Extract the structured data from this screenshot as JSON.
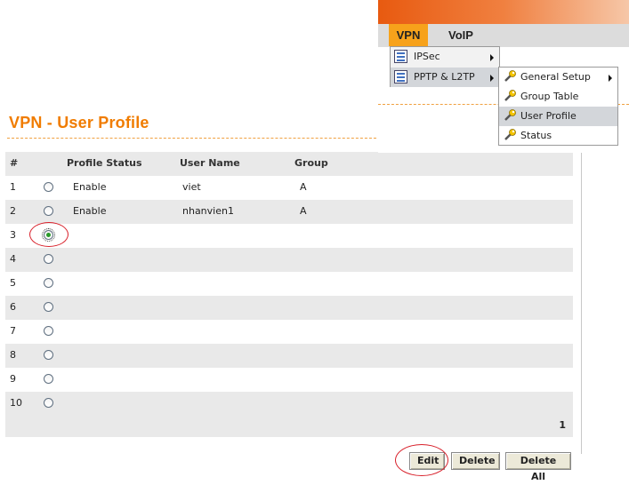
{
  "page": {
    "title": "VPN - User Profile"
  },
  "menu": {
    "tabs": [
      "VPN",
      "VoIP"
    ],
    "level1": [
      {
        "label": "IPSec",
        "icon": "list-icon",
        "has_submenu": true
      },
      {
        "label": "PPTP & L2TP",
        "icon": "list-icon",
        "has_submenu": true,
        "highlighted": true
      }
    ],
    "level2": [
      {
        "label": "General Setup",
        "icon": "wrench-icon",
        "has_submenu": true
      },
      {
        "label": "Group Table",
        "icon": "wrench-icon"
      },
      {
        "label": "User Profile",
        "icon": "wrench-icon",
        "highlighted": true
      },
      {
        "label": "Status",
        "icon": "wrench-icon"
      }
    ]
  },
  "table": {
    "headers": {
      "num": "#",
      "status": "Profile Status",
      "user": "User Name",
      "group": "Group"
    },
    "rows": [
      {
        "num": "1",
        "status": "Enable",
        "user": "viet",
        "group": "A",
        "selected": false
      },
      {
        "num": "2",
        "status": "Enable",
        "user": "nhanvien1",
        "group": "A",
        "selected": false
      },
      {
        "num": "3",
        "status": "",
        "user": "",
        "group": "",
        "selected": true
      },
      {
        "num": "4",
        "status": "",
        "user": "",
        "group": "",
        "selected": false
      },
      {
        "num": "5",
        "status": "",
        "user": "",
        "group": "",
        "selected": false
      },
      {
        "num": "6",
        "status": "",
        "user": "",
        "group": "",
        "selected": false
      },
      {
        "num": "7",
        "status": "",
        "user": "",
        "group": "",
        "selected": false
      },
      {
        "num": "8",
        "status": "",
        "user": "",
        "group": "",
        "selected": false
      },
      {
        "num": "9",
        "status": "",
        "user": "",
        "group": "",
        "selected": false
      },
      {
        "num": "10",
        "status": "",
        "user": "",
        "group": "",
        "selected": false
      }
    ],
    "page_number": "1"
  },
  "buttons": {
    "edit": "Edit",
    "delete": "Delete",
    "delete_all": "Delete All"
  },
  "colors": {
    "accent": "#f07c00",
    "menu_active": "#f7a21b",
    "annotation": "#d8202a",
    "row_alt": "#e9e9e9"
  }
}
